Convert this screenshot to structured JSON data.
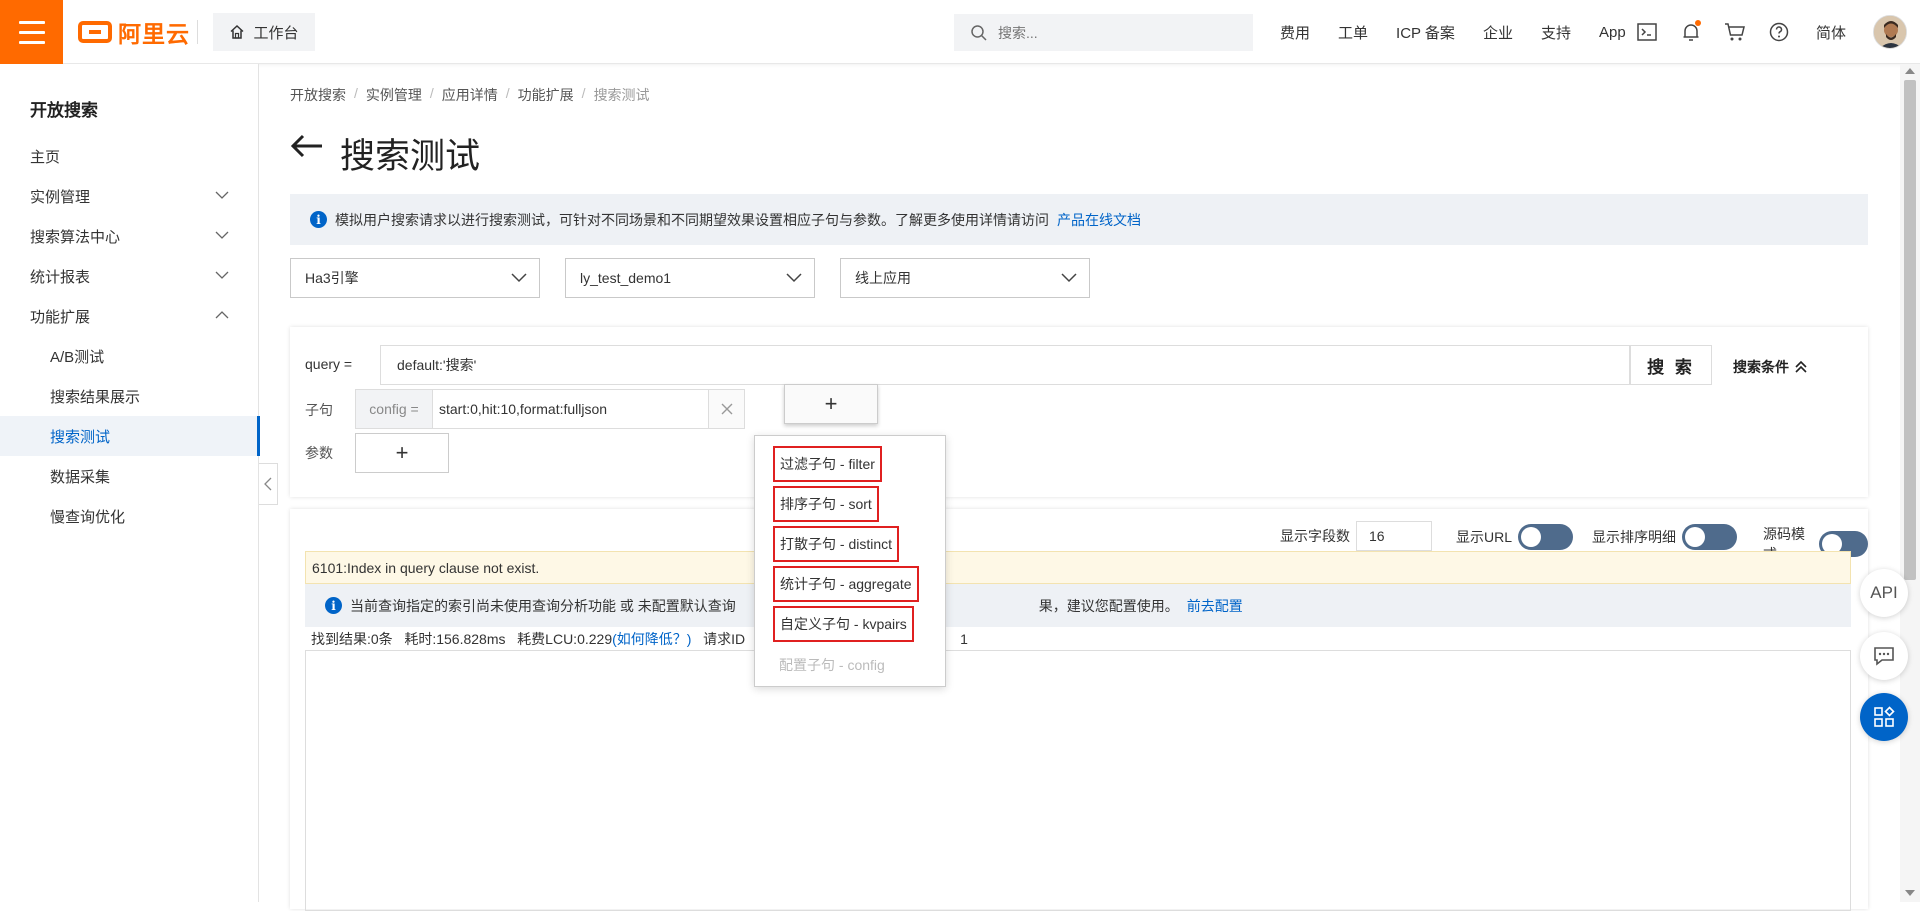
{
  "topbar": {
    "logo_text": "阿里云",
    "workbench_label": "工作台",
    "search_placeholder": "搜索...",
    "links": [
      "费用",
      "工单",
      "ICP 备案",
      "企业",
      "支持",
      "App"
    ],
    "lang": "简体",
    "icons": [
      "terminal-icon",
      "bell-icon",
      "cart-icon",
      "help-icon"
    ]
  },
  "sidebar": {
    "title": "开放搜索",
    "items": [
      {
        "label": "主页"
      },
      {
        "label": "实例管理"
      },
      {
        "label": "搜索算法中心"
      },
      {
        "label": "统计报表"
      },
      {
        "label": "功能扩展"
      }
    ],
    "sub_items": [
      {
        "label": "A/B测试"
      },
      {
        "label": "搜索结果展示"
      },
      {
        "label": "搜索测试"
      },
      {
        "label": "数据采集"
      },
      {
        "label": "慢查询优化"
      }
    ]
  },
  "breadcrumb": [
    "开放搜索",
    "实例管理",
    "应用详情",
    "功能扩展",
    "搜索测试"
  ],
  "page_title": "搜索测试",
  "notice": {
    "text": "模拟用户搜索请求以进行搜索测试，可针对不同场景和不同期望效果设置相应子句与参数。了解更多使用详情请访问",
    "link": "产品在线文档"
  },
  "selects": [
    "Ha3引擎",
    "ly_test_demo1",
    "线上应用"
  ],
  "query": {
    "label": "query =",
    "value": "default:'搜索'",
    "search_button": "搜 索",
    "conditions_toggle": "搜索条件"
  },
  "clause": {
    "label": "子句",
    "prefix": "config =",
    "value": "start:0,hit:10,format:fulljson",
    "add": "+"
  },
  "params": {
    "label": "参数",
    "add": "+"
  },
  "dropdown": {
    "items": [
      {
        "label": "过滤子句 - filter",
        "enabled": true
      },
      {
        "label": "排序子句 - sort",
        "enabled": true
      },
      {
        "label": "打散子句 - distinct",
        "enabled": true
      },
      {
        "label": "统计子句 - aggregate",
        "enabled": true
      },
      {
        "label": "自定义子句 - kvpairs",
        "enabled": true
      },
      {
        "label": "配置子句 - config",
        "enabled": false
      }
    ]
  },
  "result": {
    "field_count_label": "显示字段数",
    "field_count": "16",
    "show_url_label": "显示URL",
    "show_sort_detail_label": "显示排序明细",
    "source_mode_label": "源码模式",
    "warning": "6101:Index in query clause not exist.",
    "tip_text_before": "当前查询指定的索引尚未使用查询分析功能 或 未配置默认查询",
    "tip_text_after": "果，建议您配置使用。",
    "tip_link": "前去配置",
    "stats_before": "找到结果:0条   耗时:156.828ms   耗费LCU:0.229",
    "stats_link": "(如何降低？)",
    "stats_after": "   请求ID",
    "stats_tail": "1"
  },
  "float_buttons": {
    "api": "API"
  },
  "colors": {
    "brand": "#ff6a00",
    "link": "#0064c8",
    "highlight_box": "#e02020"
  }
}
